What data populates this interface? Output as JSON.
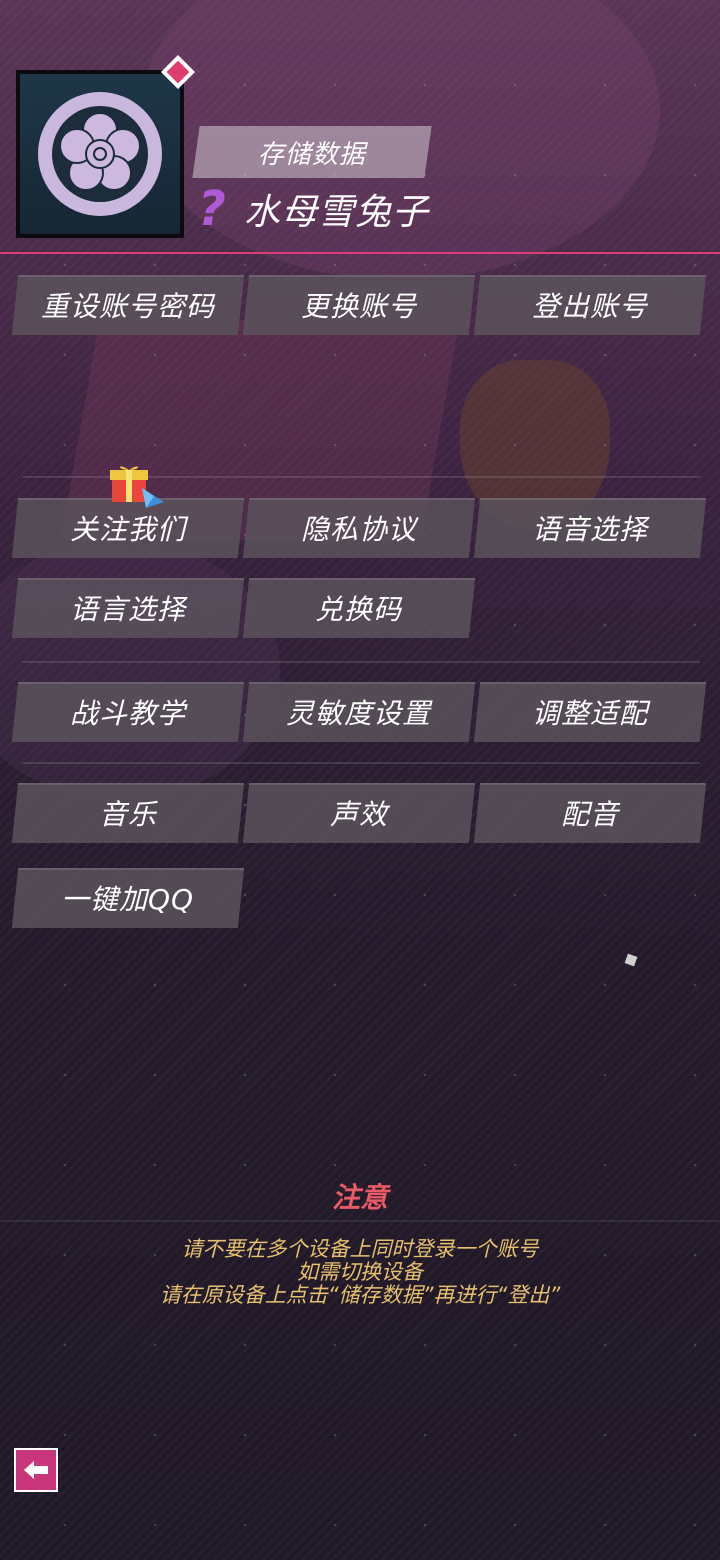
{
  "profile": {
    "save_label": "存储数据",
    "level_mark": "?",
    "username": "水母雪兔子"
  },
  "account_buttons": [
    "重设账号密码",
    "更换账号",
    "登出账号"
  ],
  "info_buttons": [
    "关注我们",
    "隐私协议",
    "语音选择",
    "语言选择",
    "兑换码"
  ],
  "setting_buttons": [
    "战斗教学",
    "灵敏度设置",
    "调整适配"
  ],
  "audio_buttons": [
    "音乐",
    "声效",
    "配音"
  ],
  "extra_buttons": [
    "一键加QQ"
  ],
  "notice": {
    "title": "注意",
    "lines": [
      "请不要在多个设备上同时登录一个账号",
      "如需切换设备",
      "请在原设备上点击“储存数据”再进行“登出”"
    ]
  },
  "colors": {
    "accent": "#d9407a",
    "notice_title": "#e85a66",
    "notice_text": "#e6c070",
    "level_mark": "#b15ad6"
  },
  "icons": {
    "avatar": "sakura-crest-icon",
    "badge": "diamond-icon",
    "gift": "gift-icon",
    "back": "back-arrow-icon"
  }
}
